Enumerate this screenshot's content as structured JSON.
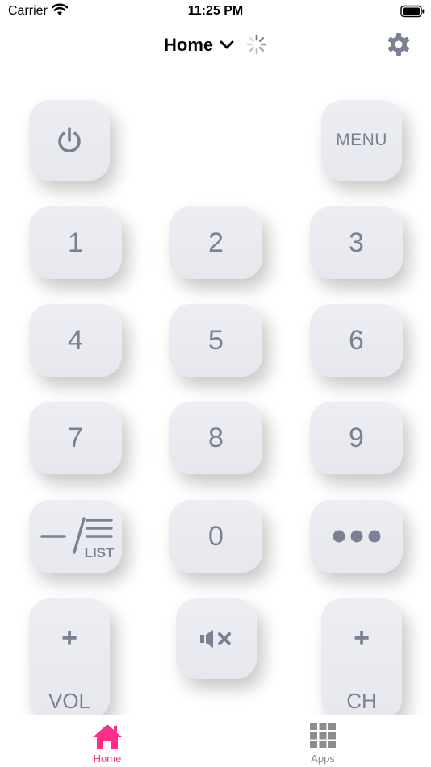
{
  "status_bar": {
    "carrier": "Carrier",
    "time": "11:25 PM"
  },
  "header": {
    "title": "Home"
  },
  "remote": {
    "menu_label": "MENU",
    "digits": [
      "1",
      "2",
      "3",
      "4",
      "5",
      "6",
      "7",
      "8",
      "9",
      "0"
    ],
    "list_label": "LIST",
    "vol_plus": "+",
    "vol_label": "VOL",
    "ch_plus": "+",
    "ch_label": "CH"
  },
  "tabs": [
    {
      "label": "Home",
      "active": true
    },
    {
      "label": "Apps",
      "active": false
    }
  ],
  "colors": {
    "accent": "#ff2d8a",
    "button": "#e9ebf0",
    "button_text": "#7b8193",
    "inactive_tab": "#8c8c8c"
  },
  "icons": {
    "status": [
      "wifi-icon",
      "battery-icon"
    ],
    "header": [
      "chevron-down-icon",
      "spinner-icon",
      "gear-icon"
    ],
    "remote": [
      "power-icon",
      "mute-icon",
      "more-dots-icon"
    ],
    "tabs": [
      "home-icon",
      "apps-grid-icon"
    ]
  }
}
